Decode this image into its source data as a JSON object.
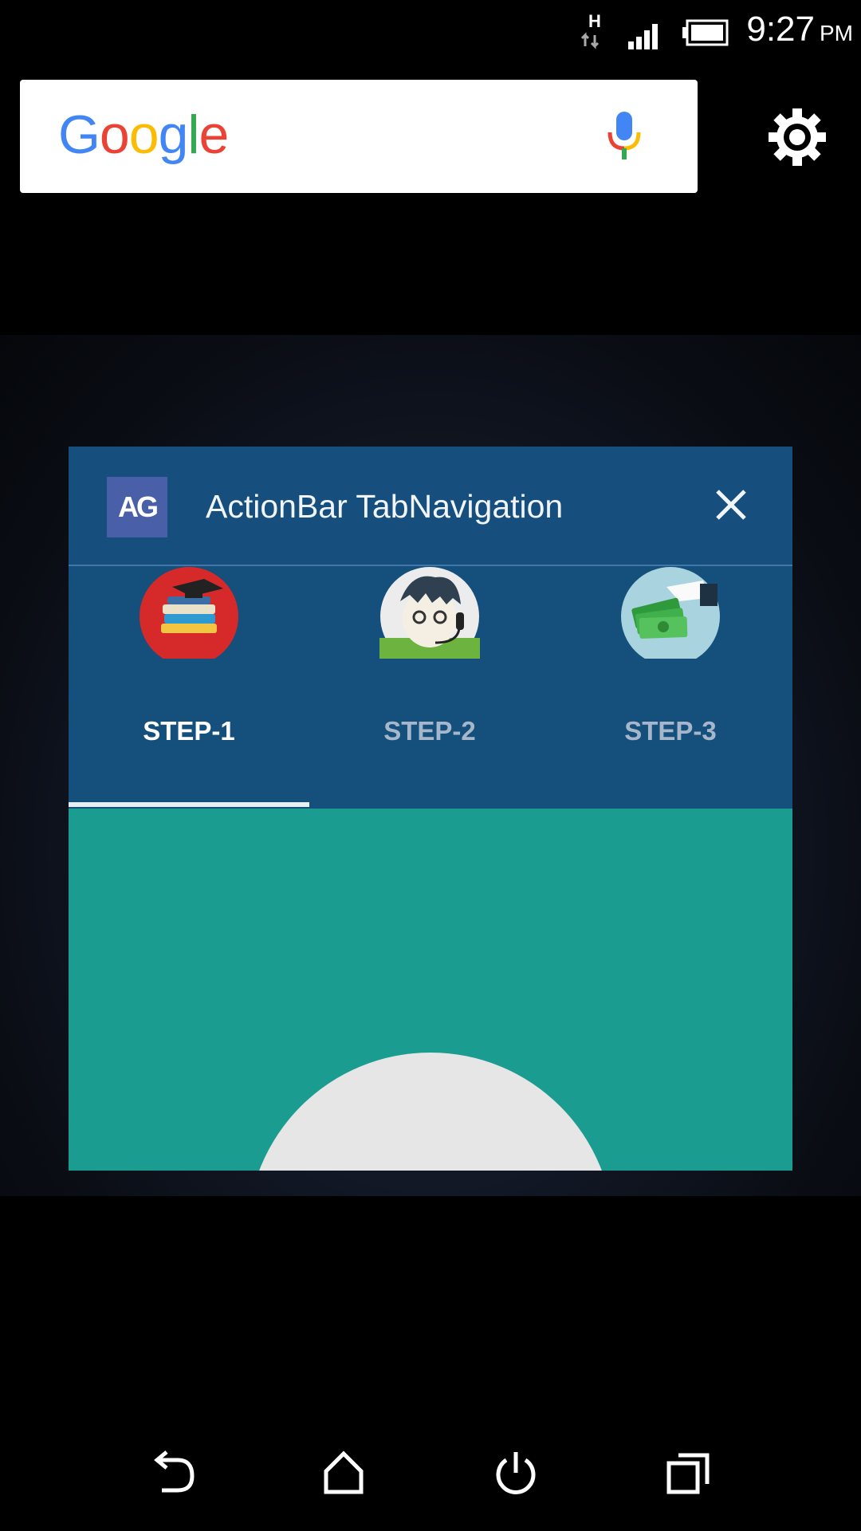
{
  "status_bar": {
    "network_type": "H",
    "time": "9:27",
    "ampm": "PM",
    "icons": [
      "data-transfer-icon",
      "signal-icon",
      "battery-icon"
    ]
  },
  "search_widget": {
    "logo_text": "Google",
    "logo_colors": [
      "#4285F4",
      "#EA4335",
      "#FBBC05",
      "#4285F4",
      "#34A853",
      "#EA4335"
    ],
    "mic_icon": "mic-icon"
  },
  "settings_icon": "gear-icon",
  "recent_card": {
    "app_icon_text": "AG",
    "app_title": "ActionBar TabNavigation",
    "close_icon": "close-icon",
    "header_color": "#164f7d",
    "content_color": "#1b9c91",
    "tabs": [
      {
        "label": "STEP-1",
        "icon": "books-graduation-icon",
        "selected": true
      },
      {
        "label": "STEP-2",
        "icon": "support-agent-icon",
        "selected": false
      },
      {
        "label": "STEP-3",
        "icon": "money-hand-icon",
        "selected": false
      }
    ]
  },
  "nav_bar": {
    "buttons": [
      "back-icon",
      "home-icon",
      "power-icon",
      "recents-icon"
    ]
  }
}
